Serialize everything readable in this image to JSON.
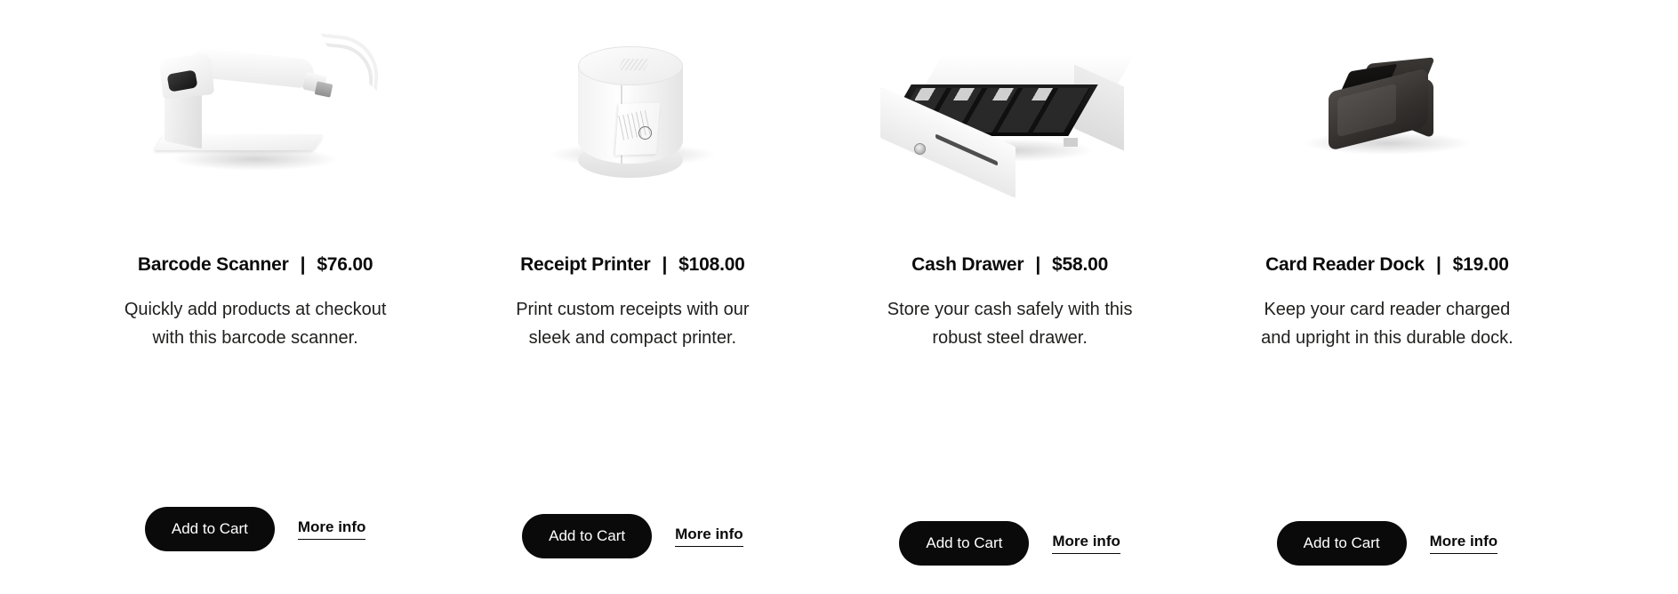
{
  "page": {
    "background_color": "#ffffff",
    "accent_color": "#0a0a0a",
    "text_color": "#20201f"
  },
  "products": [
    {
      "id": "barcode-scanner",
      "name": "Barcode Scanner",
      "separator": "|",
      "price": "$76.00",
      "description": "Quickly add products at checkout with this barcode scanner.",
      "add_to_cart_label": "Add to Cart",
      "more_info_label": "More info",
      "image_alt": "barcode-scanner-image"
    },
    {
      "id": "receipt-printer",
      "name": "Receipt Printer",
      "separator": "|",
      "price": "$108.00",
      "description": "Print custom receipts with our sleek and compact printer.",
      "add_to_cart_label": "Add to Cart",
      "more_info_label": "More info",
      "image_alt": "receipt-printer-image"
    },
    {
      "id": "cash-drawer",
      "name": "Cash Drawer",
      "separator": "|",
      "price": "$58.00",
      "description": "Store your cash safely with this robust steel drawer.",
      "add_to_cart_label": "Add to Cart",
      "more_info_label": "More info",
      "image_alt": "cash-drawer-image"
    },
    {
      "id": "card-reader-dock",
      "name": "Card Reader Dock",
      "separator": "|",
      "price": "$19.00",
      "description": "Keep your card reader charged and upright in this durable dock.",
      "add_to_cart_label": "Add to Cart",
      "more_info_label": "More info",
      "image_alt": "card-reader-dock-image"
    }
  ]
}
